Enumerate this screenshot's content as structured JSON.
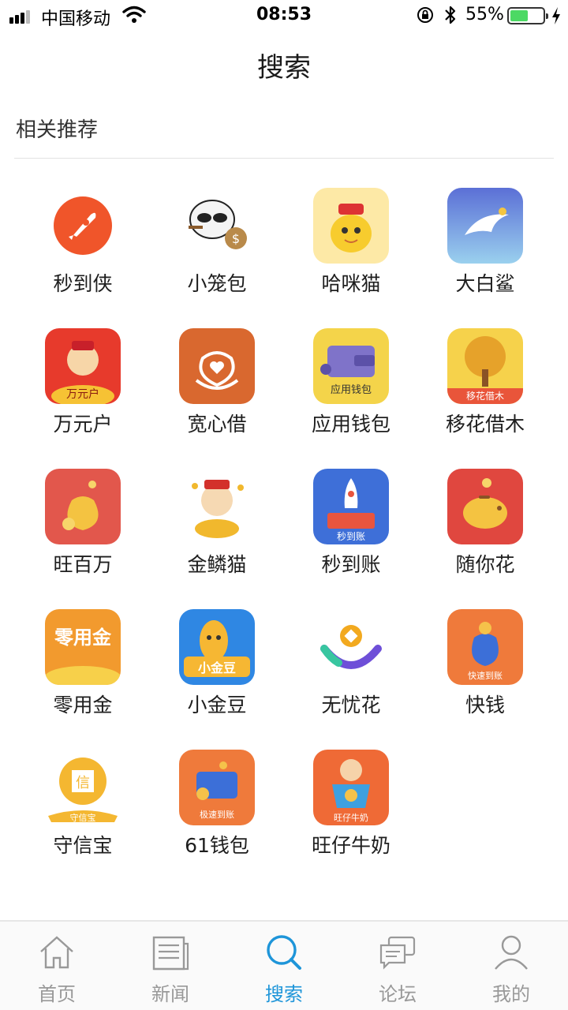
{
  "status_bar": {
    "carrier": "中国移动",
    "time": "08:53",
    "battery_percent": "55%",
    "battery_level": 0.55
  },
  "nav": {
    "title": "搜索"
  },
  "section": {
    "title": "相关推荐"
  },
  "apps": [
    {
      "name": "秒到侠",
      "icon": "rocket-icon"
    },
    {
      "name": "小笼包",
      "icon": "cartoon-panda-moneybag-icon"
    },
    {
      "name": "哈咪猫",
      "icon": "cartoon-cat-icon"
    },
    {
      "name": "大白鲨",
      "icon": "shark-icon"
    },
    {
      "name": "万元户",
      "icon": "fortune-god-icon",
      "icon_text": "万元户"
    },
    {
      "name": "宽心借",
      "icon": "money-bag-heart-icon"
    },
    {
      "name": "应用钱包",
      "icon": "wallet-icon",
      "icon_text": "应用钱包"
    },
    {
      "name": "移花借木",
      "icon": "money-tree-icon",
      "icon_text": "移花借木"
    },
    {
      "name": "旺百万",
      "icon": "gold-bag-icon"
    },
    {
      "name": "金鳞猫",
      "icon": "fortune-god-coins-icon"
    },
    {
      "name": "秒到账",
      "icon": "rocket-phone-icon",
      "icon_text": "秒到账"
    },
    {
      "name": "随你花",
      "icon": "piggy-bank-icon"
    },
    {
      "name": "零用金",
      "icon": "calligraphy-icon",
      "icon_text": "零用金"
    },
    {
      "name": "小金豆",
      "icon": "mango-character-icon",
      "icon_text": "小金豆"
    },
    {
      "name": "无忧花",
      "icon": "coin-smile-icon"
    },
    {
      "name": "快钱",
      "icon": "money-bag-blue-icon",
      "icon_text": "快速到账"
    },
    {
      "name": "守信宝",
      "icon": "credit-coin-icon",
      "icon_text": "守信宝"
    },
    {
      "name": "61钱包",
      "icon": "wallet-coin-icon",
      "icon_text": "极速到账"
    },
    {
      "name": "旺仔牛奶",
      "icon": "boy-cup-icon",
      "icon_text": "旺仔牛奶"
    }
  ],
  "tabs": [
    {
      "label": "首页",
      "icon": "home-icon",
      "active": false
    },
    {
      "label": "新闻",
      "icon": "newspaper-icon",
      "active": false
    },
    {
      "label": "搜索",
      "icon": "search-icon",
      "active": true
    },
    {
      "label": "论坛",
      "icon": "chat-bubbles-icon",
      "active": false
    },
    {
      "label": "我的",
      "icon": "user-icon",
      "active": false
    }
  ],
  "colors": {
    "accent": "#1e95d9",
    "tab_inactive": "#999999",
    "battery_green": "#4cd964"
  }
}
